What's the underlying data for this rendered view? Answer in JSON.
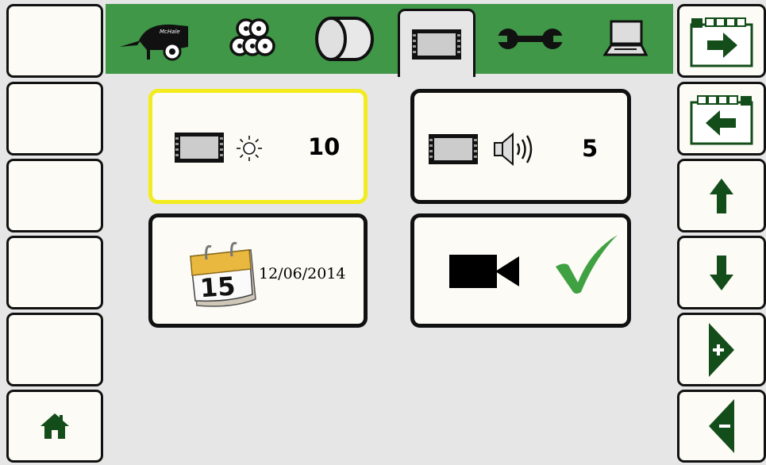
{
  "header": {
    "tabs": [
      {
        "name": "baler",
        "icon": "baler-icon"
      },
      {
        "name": "logs",
        "icon": "logs-icon"
      },
      {
        "name": "bale",
        "icon": "round-bale-icon"
      },
      {
        "name": "display",
        "icon": "display-icon",
        "active": true
      },
      {
        "name": "service",
        "icon": "wrench-icon"
      },
      {
        "name": "computer",
        "icon": "laptop-icon"
      }
    ],
    "logo_text": "McHale"
  },
  "settings": {
    "brightness": {
      "value": "10",
      "icon": "sun-icon",
      "selected": true
    },
    "volume": {
      "value": "5",
      "icon": "speaker-icon"
    },
    "date": {
      "day": "15",
      "value": "12/06/2014",
      "icon": "calendar-icon"
    },
    "camera": {
      "enabled": true,
      "icon": "camera-icon",
      "status_icon": "checkmark-icon"
    }
  },
  "left_buttons": [
    "",
    "",
    "",
    "",
    "",
    "home"
  ],
  "right_buttons": [
    "next-page",
    "previous-page",
    "up",
    "down",
    "increase",
    "decrease"
  ],
  "colors": {
    "green_bar": "#3f9747",
    "dark_green": "#134d1a",
    "check_green": "#3fa142",
    "highlight_yellow": "#f2ec1e",
    "calendar_gold": "#e9b93f"
  }
}
